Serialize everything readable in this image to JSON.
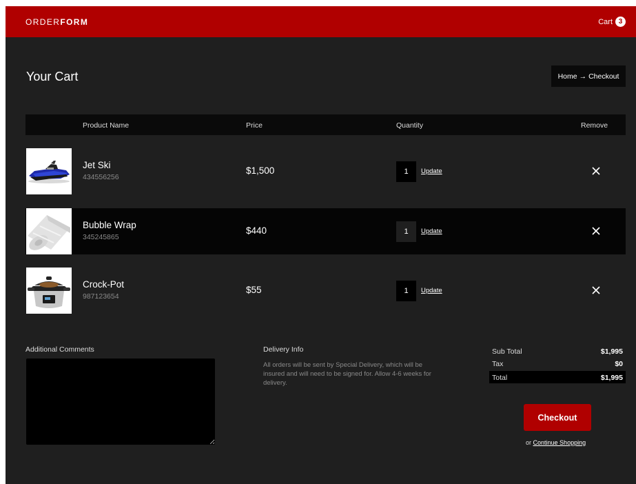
{
  "header": {
    "brand_light": "ORDER",
    "brand_bold": "FORM",
    "cart_label": "Cart",
    "cart_count": "3"
  },
  "page": {
    "title": "Your Cart",
    "breadcrumb": {
      "home": "Home",
      "arrow": "→",
      "current": "Checkout"
    }
  },
  "table": {
    "columns": {
      "product": "Product Name",
      "price": "Price",
      "quantity": "Quantity",
      "remove": "Remove"
    },
    "update_label": "Update",
    "rows": [
      {
        "name": "Jet Ski",
        "sku": "434556256",
        "price": "$1,500",
        "qty": "1",
        "image": "jet-ski-image"
      },
      {
        "name": "Bubble Wrap",
        "sku": "345245865",
        "price": "$440",
        "qty": "1",
        "image": "bubble-wrap-image"
      },
      {
        "name": "Crock-Pot",
        "sku": "987123654",
        "price": "$55",
        "qty": "1",
        "image": "crock-pot-image"
      }
    ]
  },
  "comments": {
    "label": "Additional Comments",
    "value": ""
  },
  "delivery": {
    "title": "Delivery Info",
    "text": "All orders will be sent by Special Delivery, which will be insured and will need to be signed for. Allow 4-6 weeks for delivery."
  },
  "summary": {
    "subtotal_label": "Sub Total",
    "subtotal": "$1,995",
    "tax_label": "Tax",
    "tax": "$0",
    "total_label": "Total",
    "total": "$1,995"
  },
  "actions": {
    "checkout": "Checkout",
    "continue_prefix": "or",
    "continue_link": "Continue Shopping"
  },
  "colors": {
    "accent": "#b00000",
    "background": "#1f1f1f",
    "panel": "#050505"
  }
}
